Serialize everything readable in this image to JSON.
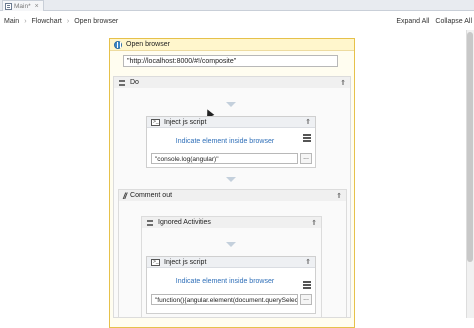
{
  "tab": {
    "label": "Main*",
    "close": "×"
  },
  "breadcrumb": [
    "Main",
    "Flowchart",
    "Open browser"
  ],
  "breadcrumb_sep": "›",
  "actions": {
    "expand_all": "Expand All",
    "collapse_all": "Collapse All"
  },
  "collapse_glyph": "⇑",
  "open_browser": {
    "title": "Open browser",
    "url": "\"http://localhost:8000/#!/composite\"",
    "icon": "globe-icon"
  },
  "do_sequence": {
    "title": "Do"
  },
  "inject1": {
    "title": "Inject js script",
    "indicate": "Indicate element inside browser",
    "script": "\"console.log(angular)\"",
    "browse": "..."
  },
  "comment_out": {
    "title": "Comment out"
  },
  "ignored": {
    "title": "Ignored Activities"
  },
  "inject2": {
    "title": "Inject js script",
    "indicate": "Indicate element inside browser",
    "script": "\"function(){angular.element(document.querySelec",
    "browse": "..."
  }
}
